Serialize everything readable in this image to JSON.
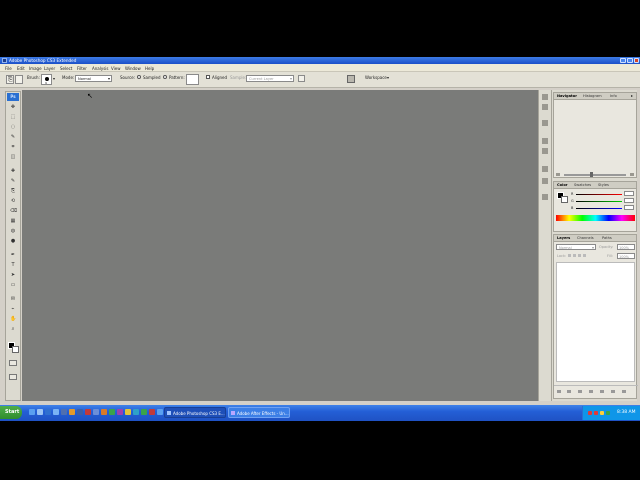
{
  "window": {
    "title": "Adobe Photoshop CS3 Extended"
  },
  "menu": [
    "File",
    "Edit",
    "Image",
    "Layer",
    "Select",
    "Filter",
    "Analysis",
    "View",
    "Window",
    "Help"
  ],
  "options_bar": {
    "brush_label": "Brush:",
    "brush_size": "9",
    "mode_label": "Mode:",
    "mode_value": "Normal",
    "source_label": "Source:",
    "sampled_label": "Sampled",
    "pattern_label": "Pattern:",
    "aligned_label": "Aligned",
    "sample_label": "Sample:",
    "sample_value": "Current Layer",
    "workspace_label": "Workspace"
  },
  "toolbox": {
    "logo": "Ps",
    "tools": [
      "move-tool",
      "marquee-tool",
      "lasso-tool",
      "quick-selection-tool",
      "crop-tool",
      "slice-tool",
      "healing-brush-tool",
      "brush-tool",
      "clone-stamp-tool",
      "history-brush-tool",
      "eraser-tool",
      "gradient-tool",
      "blur-tool",
      "dodge-tool",
      "pen-tool",
      "type-tool",
      "path-selection-tool",
      "shape-tool",
      "notes-tool",
      "eyedropper-tool",
      "hand-tool",
      "zoom-tool"
    ]
  },
  "panels": {
    "navigator_tabs": [
      "Navigator",
      "Histogram",
      "Info"
    ],
    "color_tabs": [
      "Color",
      "Swatches",
      "Styles"
    ],
    "color_channels": [
      "R",
      "G",
      "B"
    ],
    "layers_tabs": [
      "Layers",
      "Channels",
      "Paths"
    ],
    "layers_blend_mode": "Normal",
    "opacity_label": "Opacity:",
    "opacity_value": "100%",
    "lock_label": "Lock:",
    "fill_label": "Fill:",
    "fill_value": "100%"
  },
  "taskbar": {
    "start_label": "Start",
    "tasks": [
      "Adobe Photoshop CS3 E...",
      "Adobe After Effects - Un..."
    ],
    "clock": "8:38 AM"
  },
  "colors": {
    "canvas": "#7a7b79",
    "titlebar": "#2a63d8",
    "taskbar": "#245fd6",
    "foreground": "#000000",
    "background": "#ffffff"
  }
}
